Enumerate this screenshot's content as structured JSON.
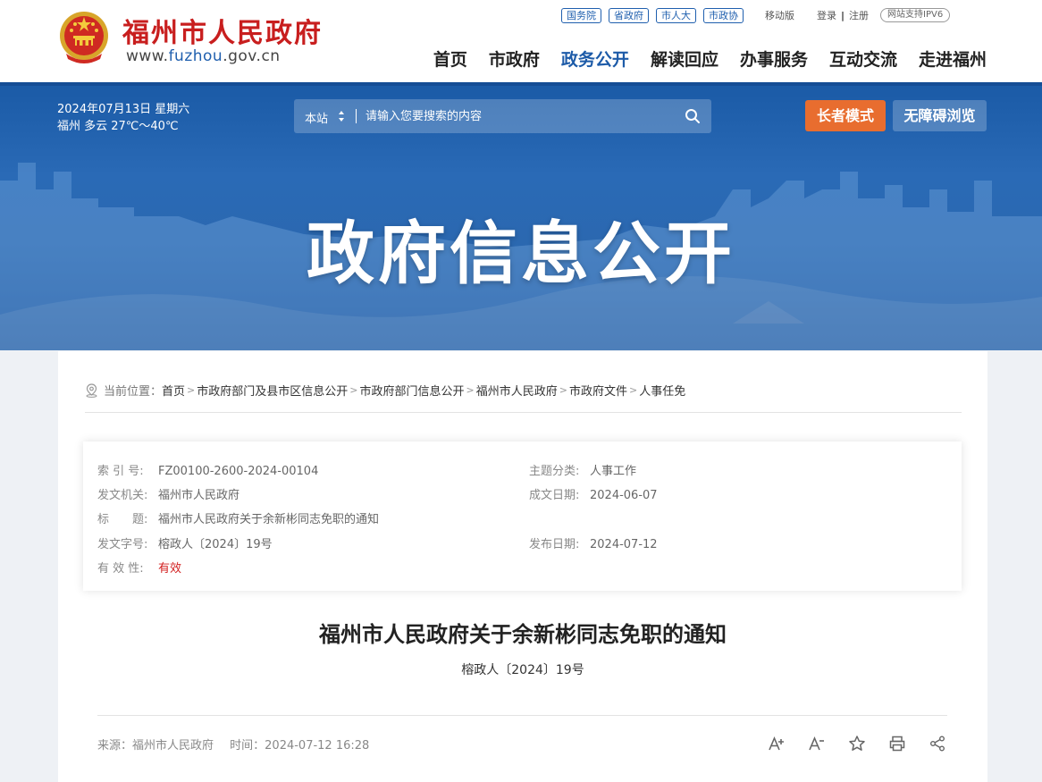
{
  "header": {
    "site_name": "福州市人民政府",
    "domain_prefix": "www.",
    "domain_main": "fuzhou",
    "domain_suffix": ".gov.cn",
    "top_links": [
      "国务院",
      "省政府",
      "市人大",
      "市政协"
    ],
    "mobile": "移动版",
    "login": "登录",
    "separator": "|",
    "register": "注册",
    "ipv6": "网站支持IPV6",
    "nav": [
      "首页",
      "市政府",
      "政务公开",
      "解读回应",
      "办事服务",
      "互动交流",
      "走进福州"
    ],
    "active_nav": "政务公开"
  },
  "banner": {
    "date": "2024年07月13日 星期六",
    "weather": "福州 多云 27℃～40℃",
    "search_scope": "本站",
    "search_placeholder": "请输入您要搜索的内容",
    "elder_mode": "长者模式",
    "accessible": "无障碍浏览",
    "title": "政府信息公开"
  },
  "breadcrumb": {
    "label": "当前位置：",
    "items": [
      "首页",
      "市政府部门及县市区信息公开",
      "市政府部门信息公开",
      "福州市人民政府",
      "市政府文件",
      "人事任免"
    ]
  },
  "meta": {
    "index_label": "索 引 号:",
    "index_value": "FZ00100-2600-2024-00104",
    "topic_label": "主题分类:",
    "topic_value": "人事工作",
    "issuer_label": "发文机关:",
    "issuer_value": "福州市人民政府",
    "created_label": "成文日期:",
    "created_value": "2024-06-07",
    "title_label": "标　　题:",
    "title_value": "福州市人民政府关于余新彬同志免职的通知",
    "docno_label": "发文字号:",
    "docno_value": "榕政人〔2024〕19号",
    "published_label": "发布日期:",
    "published_value": "2024-07-12",
    "validity_label": "有 效 性:",
    "validity_value": "有效"
  },
  "document": {
    "title": "福州市人民政府关于余新彬同志免职的通知",
    "number": "榕政人〔2024〕19号",
    "source": "来源：福州市人民政府",
    "time": "时间：2024-07-12 16:28"
  },
  "colors": {
    "brand_red": "#c81e1e",
    "nav_blue": "#1d5ba8",
    "elder_orange": "#e86d2f",
    "valid_red": "#d21f1f"
  }
}
